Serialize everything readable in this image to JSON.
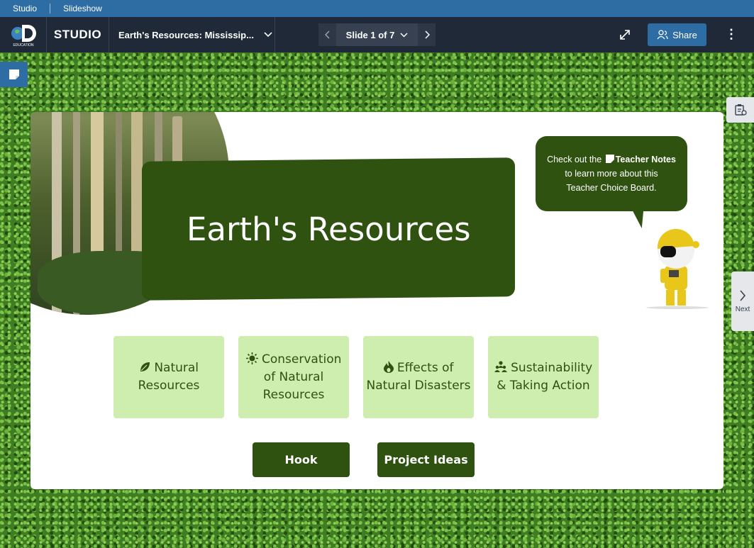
{
  "mini_bar": {
    "studio": "Studio",
    "slideshow": "Slideshow"
  },
  "toolbar": {
    "studio_label": "STUDIO",
    "logo_text": "EDUCATION",
    "doc_title": "Earth's Resources: Mississip...",
    "slide_indicator": "Slide 1 of 7",
    "share_label": "Share"
  },
  "side": {
    "next_label": "Next"
  },
  "slide": {
    "title": "Earth's Resources",
    "bubble": {
      "line1_pre": "Check out the",
      "line1_bold": "Teacher Notes",
      "line2": "to learn more about this",
      "line3": "Teacher Choice Board."
    },
    "tiles": [
      {
        "icon": "leaf-icon",
        "line1": "Natural",
        "line2": "Resources",
        "line3": ""
      },
      {
        "icon": "sun-icon",
        "line1": "Conservation",
        "line2": "of Natural",
        "line3": "Resources"
      },
      {
        "icon": "flame-icon",
        "line1": "Effects of",
        "line2": "Natural Disasters",
        "line3": ""
      },
      {
        "icon": "people-icon",
        "line1": "Sustainability",
        "line2": "& Taking Action",
        "line3": ""
      }
    ],
    "buttons": {
      "hook": "Hook",
      "project_ideas": "Project Ideas"
    }
  },
  "colors": {
    "dark_green": "#2f5211",
    "tile_green": "#cdeeae",
    "accent_blue": "#2e6da4",
    "toolbar": "#1f2937"
  }
}
